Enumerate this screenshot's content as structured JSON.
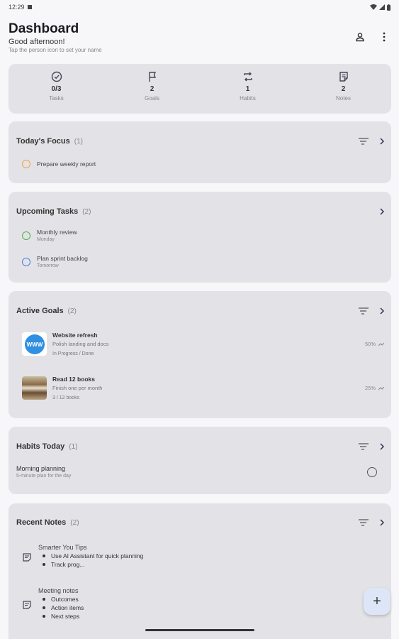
{
  "status_bar": {
    "time": "12:29"
  },
  "header": {
    "title": "Dashboard",
    "greeting": "Good afternoon!",
    "hint": "Tap the person icon to set your name"
  },
  "stats": [
    {
      "value": "0/3",
      "label": "Tasks",
      "icon": "check-circle-icon"
    },
    {
      "value": "2",
      "label": "Goals",
      "icon": "flag-icon"
    },
    {
      "value": "1",
      "label": "Habits",
      "icon": "repeat-icon"
    },
    {
      "value": "2",
      "label": "Notes",
      "icon": "note-icon"
    }
  ],
  "focus": {
    "title": "Today's Focus",
    "count": "(1)",
    "items": [
      {
        "title": "Prepare weekly report",
        "color": "#f0a040"
      }
    ]
  },
  "upcoming": {
    "title": "Upcoming Tasks",
    "count": "(2)",
    "items": [
      {
        "title": "Monthly review",
        "due": "Monday",
        "color": "#4caf50"
      },
      {
        "title": "Plan sprint backlog",
        "due": "Tomorrow",
        "color": "#4a7fe0"
      }
    ]
  },
  "goals": {
    "title": "Active Goals",
    "count": "(2)",
    "items": [
      {
        "title": "Website refresh",
        "subtitle": "Polish landing and docs",
        "status": "In Progress / Done",
        "percent": "50%",
        "image": "www-globe"
      },
      {
        "title": "Read 12 books",
        "subtitle": "Finish one per month",
        "status": "3 / 12 books",
        "percent": "25%",
        "image": "books-photo"
      }
    ]
  },
  "habits": {
    "title": "Habits Today",
    "count": "(1)",
    "items": [
      {
        "title": "Morning planning",
        "subtitle": "5-minute plan for the day"
      }
    ]
  },
  "notes": {
    "title": "Recent Notes",
    "count": "(2)",
    "items": [
      {
        "title": "Smarter You Tips",
        "bullets": [
          "Use AI Assistant for quick planning",
          "Track prog..."
        ]
      },
      {
        "title": "Meeting notes",
        "bullets": [
          "Outcomes",
          "Action items",
          "Next steps"
        ]
      }
    ]
  },
  "fab": {
    "label": "+"
  }
}
